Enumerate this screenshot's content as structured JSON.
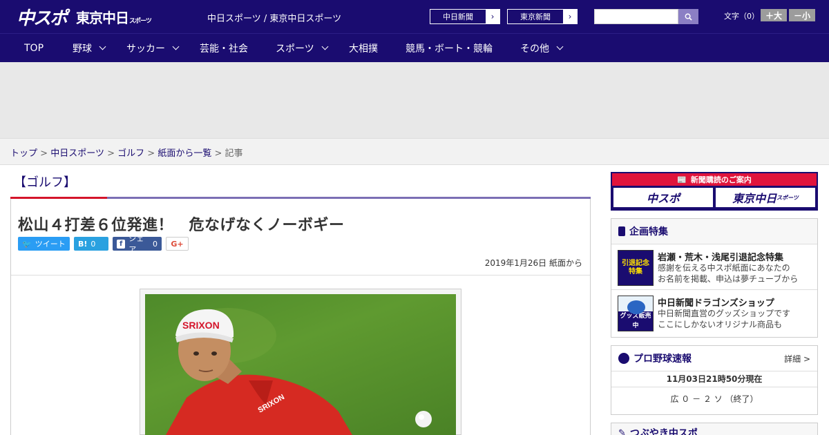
{
  "header": {
    "logo_main": "中スポ",
    "logo_sub": "東京中日",
    "logo_sub_small": "スポーツ",
    "site_title": "中日スポーツ / 東京中日スポーツ",
    "links": [
      {
        "label": "中日新聞"
      },
      {
        "label": "東京新聞"
      }
    ],
    "search_placeholder": "",
    "font_label": "文字（0）",
    "font_larger": "＋大",
    "font_smaller": "－小"
  },
  "nav": {
    "items": [
      {
        "label": "TOP",
        "dropdown": false
      },
      {
        "label": "野球",
        "dropdown": true
      },
      {
        "label": "サッカー",
        "dropdown": true
      },
      {
        "label": "芸能・社会",
        "dropdown": false
      },
      {
        "label": "スポーツ",
        "dropdown": true
      },
      {
        "label": "大相撲",
        "dropdown": false
      },
      {
        "label": "競馬・ボート・競輪",
        "dropdown": false
      },
      {
        "label": "その他",
        "dropdown": true
      }
    ]
  },
  "breadcrumb": {
    "items": [
      "トップ",
      "中日スポーツ",
      "ゴルフ",
      "紙面から一覧"
    ],
    "current": "記事",
    "separator": ">"
  },
  "article": {
    "category": "【ゴルフ】",
    "title": "松山４打差６位発進！　危なげなくノーボギー",
    "date": "2019年1月26日 紙面から",
    "share": {
      "tweet": "ツイート",
      "hatena_icon": "B!",
      "hatena_count": "0",
      "facebook_label": "シェア",
      "facebook_count": "0",
      "gplus_icon": "G+"
    },
    "photo_text": {
      "cap": "SRIXON",
      "shirt": "SRIXON"
    }
  },
  "sidebar": {
    "subscription": {
      "header": "新聞購読のご案内",
      "btn1": "中スポ",
      "btn2": "東京中日",
      "btn2_small": "スポーツ"
    },
    "features": {
      "heading": "企画特集",
      "items": [
        {
          "title": "岩瀬・荒木・浅尾引退記念特集",
          "desc1": "感謝を伝える中スポ紙面にあなたの",
          "desc2": "お名前を掲載、申込は夢チューブから",
          "thumb_text": "引退記念特集"
        },
        {
          "title": "中日新聞ドラゴンズショップ",
          "desc1": "中日新聞直営のグッズショップです",
          "desc2": "ここにしかないオリジナル商品も",
          "thumb_text": "グッズ販売中"
        }
      ]
    },
    "scores": {
      "heading": "プロ野球速報",
      "detail": "詳細 >",
      "time": "11月03日21時50分現在",
      "game": "広 ０ － ２ ソ （終了）"
    },
    "next_heading": "つぶやき中スポ"
  },
  "colors": {
    "brand": "#1a0c70",
    "accent_red": "#d4142a",
    "twitter": "#2a9df4",
    "hatena": "#2aa1e0",
    "facebook": "#3b5998"
  }
}
